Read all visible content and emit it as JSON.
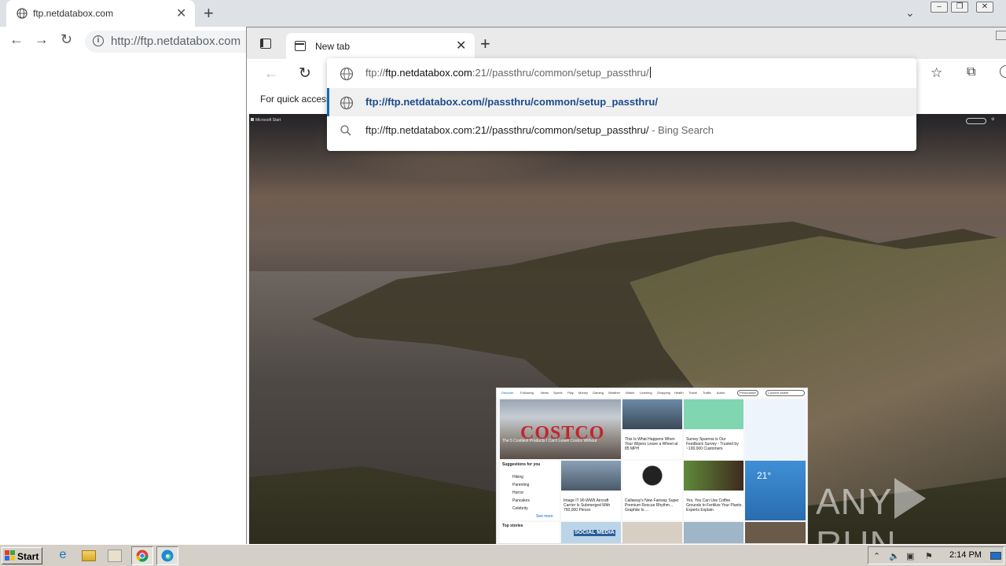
{
  "chrome": {
    "tab_title": "ftp.netdatabox.com",
    "url": "http://ftp.netdatabox.com"
  },
  "edge": {
    "tab_title": "New tab",
    "favorites_bar_text": "For quick access",
    "address_input": {
      "dim_prefix": "ftp://",
      "host": "ftp.netdatabox.com",
      "rest": ":21//passthru/common/setup_passthru/"
    },
    "suggestions": [
      {
        "kind": "url",
        "text": "ftp://ftp.netdatabox.com//passthru/common/setup_passthru/"
      },
      {
        "kind": "search",
        "text": "ftp://ftp.netdatabox.com:21//passthru/common/setup_passthru/",
        "suffix": "- Bing Search"
      }
    ],
    "newtab": {
      "brand": "Microsoft Start",
      "feed": {
        "nav_items": [
          "Discover",
          "Following",
          "News",
          "Sports",
          "Play",
          "Money",
          "Gaming",
          "Weather",
          "Watch",
          "Learning",
          "Shopping",
          "Health",
          "Travel",
          "Traffic",
          "Autos"
        ],
        "personalize": "Personalize",
        "content_visible": "Content visible",
        "costco_logo": "COSTCO",
        "costco_caption": "The 5 Costliest Products I Can't Leave Costco Without",
        "card2_caption": "This Is What Happens When Your Wipers Leave a Wheel at 85 MPH",
        "card3_caption": "Survey Sparrow is Our Feedback Survey - Trusted by ~100,000 Customers",
        "card5_caption": "Image IT 90-WWII Aircraft Carrier Is Submerged With 750,000 Pieces",
        "card6_caption": "Callaway's New Fairway Super Premium Rescue Rhythm... Graphite Is ...",
        "card7_caption": "Yes, You Can Use Coffee Grounds to Fertilize Your Plants. Experts Explain",
        "suggestions_title": "Suggestions for you",
        "suggestions": [
          "Hiking",
          "Parenting",
          "Horror",
          "Pancakes",
          "Celebrity"
        ],
        "see_more": "See more",
        "weather_temp": "21°",
        "social_media": "SOCIAL MEDIA",
        "top_stories": "Top stories"
      }
    }
  },
  "watermark": {
    "left": "ANY",
    "right": "RUN"
  },
  "taskbar": {
    "start_label": "Start",
    "time": "2:14 PM"
  }
}
